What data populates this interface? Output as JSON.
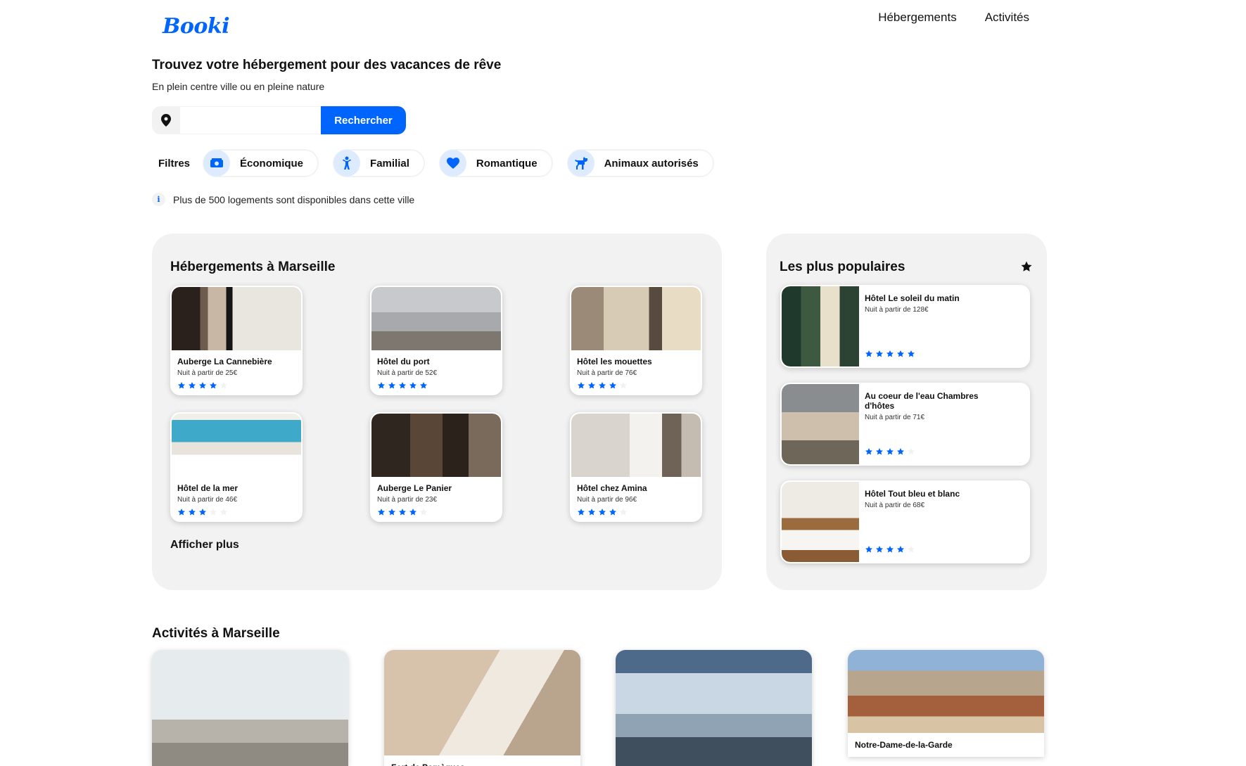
{
  "brand": {
    "logo": "Booki",
    "accent": "#0065FC"
  },
  "nav": {
    "items": [
      "Hébergements",
      "Activités"
    ]
  },
  "hero": {
    "title": "Trouvez votre hébergement pour des vacances de rêve",
    "subtitle": "En plein centre ville ou en pleine nature"
  },
  "search": {
    "value": "",
    "placeholder": "",
    "button": "Rechercher",
    "icon": "location-pin-icon"
  },
  "filters": {
    "label": "Filtres",
    "items": [
      {
        "label": "Économique",
        "icon": "money-icon"
      },
      {
        "label": "Familial",
        "icon": "child-icon"
      },
      {
        "label": "Romantique",
        "icon": "heart-icon"
      },
      {
        "label": "Animaux autorisés",
        "icon": "dog-icon"
      }
    ]
  },
  "info": {
    "text": "Plus de 500 logements sont disponibles dans cette ville",
    "icon": "info-icon"
  },
  "hebergements": {
    "title": "Hébergements à Marseille",
    "more": "Afficher plus",
    "items": [
      {
        "name": "Auberge La Cannebière",
        "price": "Nuit à partir de 25€",
        "rating": 4
      },
      {
        "name": "Hôtel du port",
        "price": "Nuit à partir de 52€",
        "rating": 5
      },
      {
        "name": "Hôtel les mouettes",
        "price": "Nuit à partir de 76€",
        "rating": 4
      },
      {
        "name": "Hôtel de la mer",
        "price": "Nuit à partir de 46€",
        "rating": 3
      },
      {
        "name": "Auberge Le Panier",
        "price": "Nuit à partir de 23€",
        "rating": 4
      },
      {
        "name": "Hôtel chez Amina",
        "price": "Nuit à partir de 96€",
        "rating": 4
      }
    ]
  },
  "populaires": {
    "title": "Les plus populaires",
    "icon": "star-icon",
    "items": [
      {
        "name": "Hôtel Le soleil du matin",
        "price": "Nuit à partir de 128€",
        "rating": 5
      },
      {
        "name": "Au coeur de l'eau Chambres d'hôtes",
        "price": "Nuit à partir de 71€",
        "rating": 4
      },
      {
        "name": "Hôtel Tout bleu et blanc",
        "price": "Nuit à partir de 68€",
        "rating": 4
      }
    ]
  },
  "activites": {
    "title": "Activités à Marseille",
    "items": [
      {
        "name": ""
      },
      {
        "name": "Fort de Pomègues"
      },
      {
        "name": ""
      },
      {
        "name": "Notre-Dame-de-la-Garde"
      }
    ]
  }
}
